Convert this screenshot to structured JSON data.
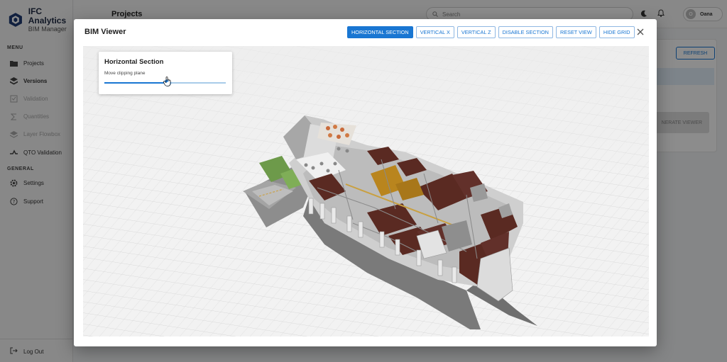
{
  "app": {
    "brand_title": "IFC Analytics",
    "brand_subtitle": "BIM Manager",
    "page_title": "Projects",
    "search_placeholder": "Search",
    "user_name": "Oana",
    "user_initial": "O"
  },
  "sidebar": {
    "menu_label": "MENU",
    "general_label": "GENERAL",
    "menu_items": [
      {
        "label": "Projects",
        "icon": "folder-icon"
      },
      {
        "label": "Versions",
        "icon": "layers-icon"
      },
      {
        "label": "Validation",
        "icon": "checklist-icon"
      },
      {
        "label": "Quantities",
        "icon": "sigma-icon"
      },
      {
        "label": "Layer Flowbox",
        "icon": "stack-icon"
      },
      {
        "label": "QTO Validation",
        "icon": "compare-icon"
      }
    ],
    "general_items": [
      {
        "label": "Settings",
        "icon": "gear-icon"
      },
      {
        "label": "Support",
        "icon": "help-icon"
      }
    ],
    "logout_label": "Log Out"
  },
  "background_panel": {
    "refresh_label": "REFRESH",
    "generate_label": "NERATE VIEWER"
  },
  "modal": {
    "title": "BIM Viewer",
    "buttons": {
      "horizontal_section": "HORIZONTAL SECTION",
      "vertical_x": "VERTICAL X",
      "vertical_z": "VERTICAL Z",
      "disable_section": "DISABLE SECTION",
      "reset_view": "RESET VIEW",
      "hide_grid": "HIDE GRID"
    },
    "active_button": "horizontal_section",
    "section_panel": {
      "title": "Horizontal Section",
      "subtitle": "Move clipping plane",
      "slider_value": 0.52
    }
  },
  "colors": {
    "accent": "#1976d2",
    "roof_dark": "#5a2a22",
    "wood": "#b9851e",
    "green_roof": "#6d9a4a"
  }
}
